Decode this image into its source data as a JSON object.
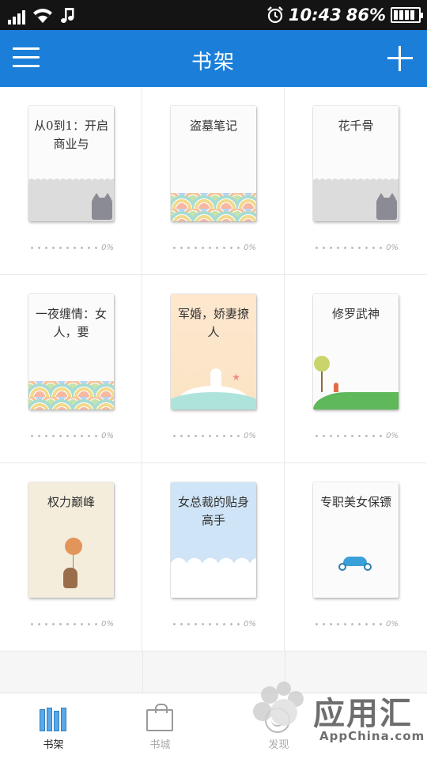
{
  "status_bar": {
    "time": "10:43",
    "battery_percent": "86%",
    "icons": [
      "signal-icon",
      "wifi-icon",
      "music-note-icon",
      "alarm-clock-icon",
      "battery-icon"
    ]
  },
  "app_bar": {
    "title": "书架",
    "menu_icon": "hamburger-menu-icon",
    "add_icon": "plus-icon",
    "color": "#1b7fd9"
  },
  "shelf": {
    "books": [
      {
        "title": "从0到1：开启商业与",
        "progress": "0%",
        "cover": "gray-cat"
      },
      {
        "title": "盗墓笔记",
        "progress": "0%",
        "cover": "waves"
      },
      {
        "title": "花千骨",
        "progress": "0%",
        "cover": "gray-cat"
      },
      {
        "title": "一夜缠情：女人，要",
        "progress": "0%",
        "cover": "waves"
      },
      {
        "title": "军婚，娇妻撩人",
        "progress": "0%",
        "cover": "peach"
      },
      {
        "title": "修罗武神",
        "progress": "0%",
        "cover": "meadow"
      },
      {
        "title": "权力巅峰",
        "progress": "0%",
        "cover": "beige-balloon"
      },
      {
        "title": "女总裁的贴身高手",
        "progress": "0%",
        "cover": "sky-cloud"
      },
      {
        "title": "专职美女保镖",
        "progress": "0%",
        "cover": "scooter"
      }
    ]
  },
  "bottom_nav": {
    "items": [
      {
        "label": "书架",
        "icon": "bookshelf-icon",
        "active": true
      },
      {
        "label": "书城",
        "icon": "shopping-bag-icon",
        "active": false
      },
      {
        "label": "发现",
        "icon": "smile-face-icon",
        "active": false
      }
    ]
  },
  "watermark": {
    "title": "应用汇",
    "subtitle": "AppChina.com"
  }
}
